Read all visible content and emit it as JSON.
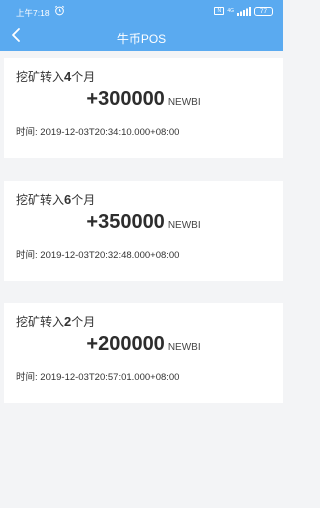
{
  "status_bar": {
    "time": "上午7:18",
    "network": "4G",
    "battery": "77"
  },
  "header": {
    "title": "牛币POS"
  },
  "records": [
    {
      "title_prefix": "挖矿转入",
      "months": "4",
      "title_suffix": "个月",
      "amount": "+300000",
      "unit": "NEWBI",
      "time_label": "时间:",
      "time": "2019-12-03T20:34:10.000+08:00"
    },
    {
      "title_prefix": "挖矿转入",
      "months": "6",
      "title_suffix": "个月",
      "amount": "+350000",
      "unit": "NEWBI",
      "time_label": "时间:",
      "time": "2019-12-03T20:32:48.000+08:00"
    },
    {
      "title_prefix": "挖矿转入",
      "months": "2",
      "title_suffix": "个月",
      "amount": "+200000",
      "unit": "NEWBI",
      "time_label": "时间:",
      "time": "2019-12-03T20:57:01.000+08:00"
    }
  ]
}
